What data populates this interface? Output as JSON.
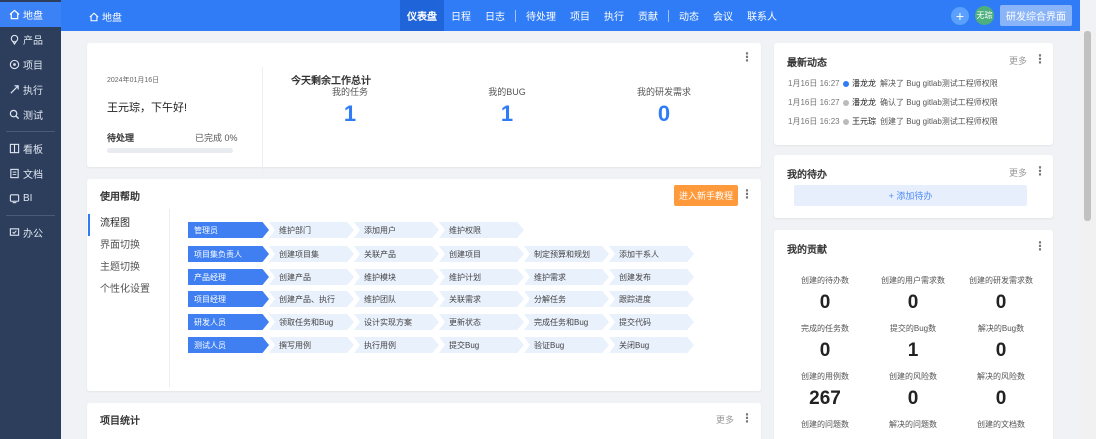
{
  "sidebar": {
    "items": [
      {
        "label": "地盘",
        "icon": "home-icon"
      },
      {
        "label": "产品",
        "icon": "product-icon"
      },
      {
        "label": "项目",
        "icon": "project-icon"
      },
      {
        "label": "执行",
        "icon": "execution-icon"
      },
      {
        "label": "测试",
        "icon": "test-icon"
      },
      {
        "label": "看板",
        "icon": "kanban-icon"
      },
      {
        "label": "文档",
        "icon": "doc-icon"
      },
      {
        "label": "BI",
        "icon": "bi-icon"
      },
      {
        "label": "办公",
        "icon": "office-icon"
      }
    ]
  },
  "topbar": {
    "breadcrumb": "地盘",
    "nav": [
      "仪表盘",
      "日程",
      "日志",
      "待处理",
      "项目",
      "执行",
      "贡献",
      "动态",
      "会议",
      "联系人"
    ],
    "avatar_text": "无琮",
    "switch_label": "研发综合界面"
  },
  "welcome": {
    "date": "2024年01月16日",
    "greeting": "王元琮，下午好!",
    "pending_label": "待处理",
    "done_label": "已完成 0%",
    "progress": 0,
    "today_title": "今天剩余工作总计",
    "stats": [
      {
        "label": "我的任务",
        "value": "1"
      },
      {
        "label": "我的BUG",
        "value": "1"
      },
      {
        "label": "我的研发需求",
        "value": "0"
      }
    ]
  },
  "help": {
    "title": "使用帮助",
    "button": "进入新手教程",
    "menu": [
      "流程图",
      "界面切换",
      "主题切换",
      "个性化设置"
    ],
    "rows": [
      {
        "role": "管理员",
        "steps": [
          "维护部门",
          "添加用户",
          "维护权限"
        ]
      },
      {
        "role": "项目集负责人",
        "steps": [
          "创建项目集",
          "关联产品",
          "创建项目",
          "制定预算和规划",
          "添加干系人"
        ]
      },
      {
        "role": "产品经理",
        "steps": [
          "创建产品",
          "维护模块",
          "维护计划",
          "维护需求",
          "创建发布"
        ]
      },
      {
        "role": "项目经理",
        "steps": [
          "创建产品、执行",
          "维护团队",
          "关联需求",
          "分解任务",
          "跟踪进度"
        ]
      },
      {
        "role": "研发人员",
        "steps": [
          "领取任务和Bug",
          "设计实现方案",
          "更新状态",
          "完成任务和Bug",
          "提交代码"
        ]
      },
      {
        "role": "测试人员",
        "steps": [
          "撰写用例",
          "执行用例",
          "提交Bug",
          "验证Bug",
          "关闭Bug"
        ]
      }
    ]
  },
  "project_stats": {
    "title": "项目统计",
    "more": "更多"
  },
  "activity": {
    "title": "最新动态",
    "more": "更多",
    "items": [
      {
        "time": "1月16日 16:27",
        "user": "潘龙龙",
        "text": "解决了 Bug gitlab测试工程师权限"
      },
      {
        "time": "1月16日 16:27",
        "user": "潘龙龙",
        "text": "确认了 Bug gitlab测试工程师权限"
      },
      {
        "time": "1月16日 16:23",
        "user": "王元琮",
        "text": "创建了 Bug gitlab测试工程师权限"
      }
    ]
  },
  "todo": {
    "title": "我的待办",
    "more": "更多",
    "add_label": "+ 添加待办"
  },
  "contrib": {
    "title": "我的贡献",
    "items": [
      {
        "label": "创建的待办数",
        "value": "0"
      },
      {
        "label": "创建的用户需求数",
        "value": "0"
      },
      {
        "label": "创建的研发需求数",
        "value": "0"
      },
      {
        "label": "完成的任务数",
        "value": "0"
      },
      {
        "label": "提交的Bug数",
        "value": "1"
      },
      {
        "label": "解决的Bug数",
        "value": "0"
      },
      {
        "label": "创建的用例数",
        "value": "267"
      },
      {
        "label": "创建的风险数",
        "value": "0"
      },
      {
        "label": "解决的风险数",
        "value": "0"
      },
      {
        "label": "创建的问题数",
        "value": ""
      },
      {
        "label": "解决的问题数",
        "value": ""
      },
      {
        "label": "创建的文档数",
        "value": ""
      }
    ]
  },
  "colors": {
    "primary": "#2f7cf6",
    "sidebar": "#2c3e5c",
    "orange": "#ff9a3c"
  }
}
